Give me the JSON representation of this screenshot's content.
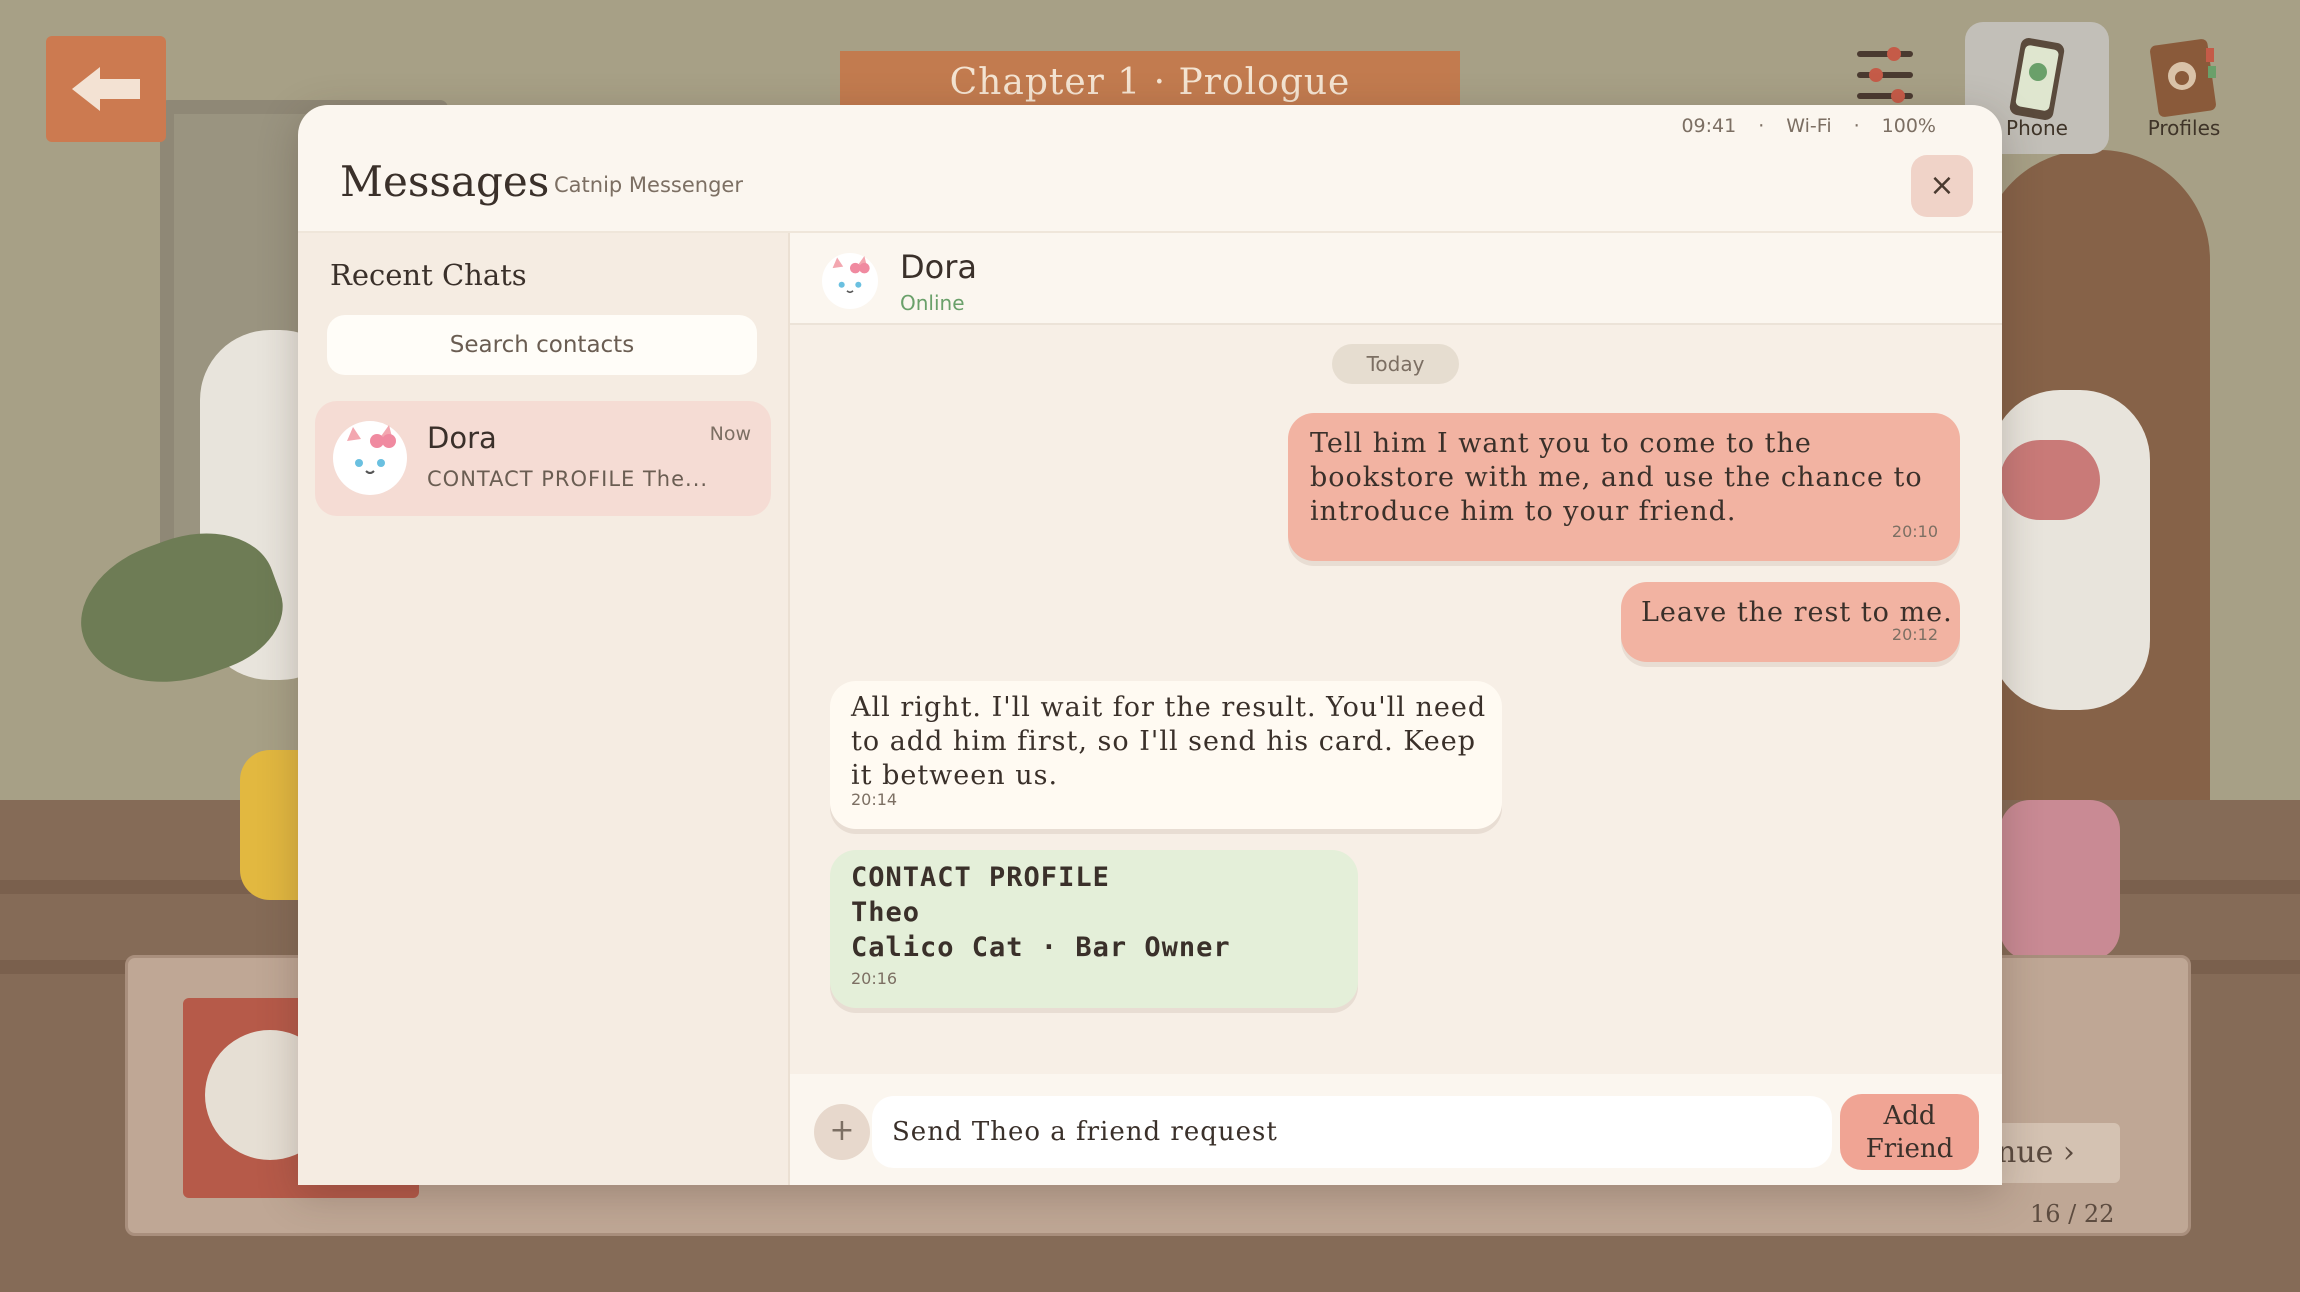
{
  "hud": {
    "chapter_title": "Chapter 1 · Prologue",
    "phone_label": "Phone",
    "profiles_label": "Profiles",
    "back_icon": "arrow-left-icon",
    "settings_icon": "sliders-icon"
  },
  "background": {
    "next_label": "nue ›",
    "page_counter": "16 / 22"
  },
  "status_bar": {
    "time": "09:41",
    "sep1": "·",
    "network": "Wi-Fi",
    "sep2": "·",
    "battery": "100%"
  },
  "modal": {
    "title": "Messages",
    "subtitle": "Catnip Messenger",
    "close_label": "×"
  },
  "sidebar": {
    "heading": "Recent Chats",
    "search_placeholder": "Search contacts",
    "chats": [
      {
        "name": "Dora",
        "time": "Now",
        "preview": "CONTACT PROFILE The..."
      }
    ]
  },
  "conversation": {
    "contact_name": "Dora",
    "presence": "Online",
    "day_label": "Today",
    "messages": [
      {
        "direction": "outgoing",
        "text": "Tell him I want you to come to the bookstore with me, and use the chance to introduce him to your friend.",
        "time": "20:10"
      },
      {
        "direction": "outgoing",
        "text": "Leave the rest to me.",
        "time": "20:12"
      },
      {
        "direction": "incoming",
        "text": "All right. I'll wait for the result. You'll need to add him first, so I'll send his card. Keep it between us.",
        "time": "20:14"
      },
      {
        "direction": "incoming",
        "type": "contact_card",
        "header": "CONTACT PROFILE",
        "name": "Theo",
        "detail": "Calico Cat · Bar Owner",
        "time": "20:16"
      }
    ]
  },
  "composer": {
    "plus_label": "+",
    "input_value": "Send Theo a friend request",
    "send_label": "Add Friend"
  },
  "colors": {
    "accent": "#f0a494",
    "outgoing_bubble": "#f2b3a2",
    "incoming_bubble": "#fffaf2",
    "card_bubble": "#e4efd9",
    "online": "#6aa06a"
  }
}
